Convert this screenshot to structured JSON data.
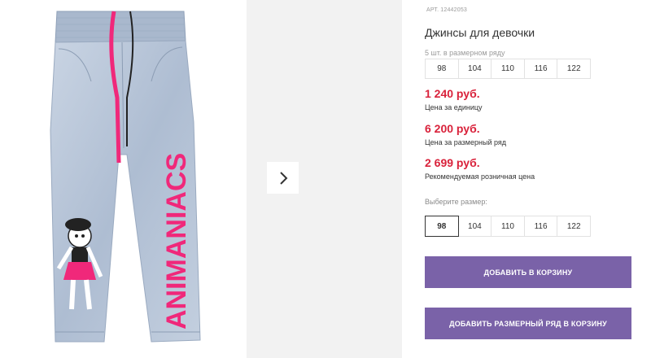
{
  "product": {
    "art_label": "АРТ.",
    "art_number": "12442053",
    "title": "Джинсы для девочки",
    "row_note": "5 шт. в размерном ряду",
    "row_sizes": [
      "98",
      "104",
      "110",
      "116",
      "122"
    ],
    "prices": [
      {
        "value": "1 240 руб.",
        "note": "Цена за единицу"
      },
      {
        "value": "6 200 руб.",
        "note": "Цена за размерный ряд"
      },
      {
        "value": "2 699 руб.",
        "note": "Рекомендуемая розничная цена"
      }
    ],
    "choose_label": "Выберите размер:",
    "size_options": [
      "98",
      "104",
      "110",
      "116",
      "122"
    ],
    "selected_size": "98",
    "add_to_cart": "ДОБАВИТЬ В КОРЗИНУ",
    "add_row_to_cart": "ДОБАВИТЬ РАЗМЕРНЫЙ РЯД В КОРЗИНУ",
    "print_text": "ANIMANIACS"
  },
  "colors": {
    "price": "#d9223b",
    "button": "#7a62a8",
    "denim": "#b9c6d8",
    "pink": "#f0287a"
  },
  "icons": {
    "next": "chevron-right-icon"
  }
}
